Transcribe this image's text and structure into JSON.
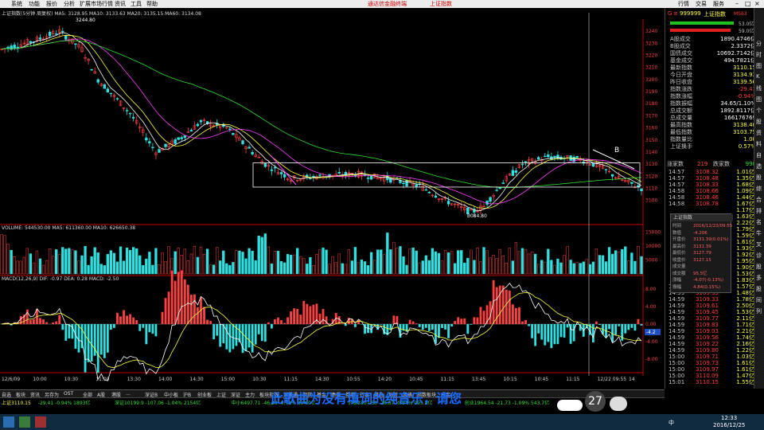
{
  "menu": {
    "items": [
      "系统",
      "功能",
      "报价",
      "分析",
      "扩展市场行情",
      "资讯",
      "工具",
      "帮助"
    ],
    "center_title": "通达信金融终端",
    "center_sub": "上证指数",
    "right_items": [
      "行情",
      "交易",
      "服务"
    ]
  },
  "main_chart": {
    "header": "上证指数(5分钟 周复权) MA5: 3128.95  MA10: 3133.63  MA20: 3135.15  MA60: 3134.08",
    "price_ticks": [
      "3240",
      "3230",
      "3220",
      "3210",
      "3200",
      "3190",
      "3180",
      "3170",
      "3160",
      "3150",
      "3140",
      "3130",
      "3120",
      "3110",
      "3100"
    ],
    "high_marker": "3244.80",
    "low_marker": "3084.80",
    "annotation_b": "B"
  },
  "volume_chart": {
    "header": "VOLUME: 544530.00  MA5: 611360.00  MA10: 626650.38",
    "ticks": [
      "15000",
      "10000",
      "5000",
      "X100"
    ]
  },
  "macd_chart": {
    "header": "MACD(12,26,9)  DIF: -0.97  DEA: 0.28  MACD: -2.50",
    "ticks": [
      "8.00",
      "4.00",
      "0.00",
      "-4.00",
      "-8.00"
    ],
    "marker": "-4.2"
  },
  "time_axis": [
    "12/6/09",
    "10:00",
    "10:30",
    "11:00",
    "13:30",
    "14:00",
    "14:30",
    "15:00",
    "10:30",
    "11:15",
    "14:30",
    "10:55",
    "14:20",
    "10:45",
    "11:15",
    "13:45",
    "10:15",
    "10:45",
    "11:15",
    "12/22 09:55",
    "14"
  ],
  "right_panel": {
    "code": "999999",
    "name": "上证指数",
    "tag": "MS63",
    "bar_a": "53.0亿",
    "bar_b": "59.0亿",
    "stats": [
      {
        "label": "A股成交",
        "value": "1890.4746亿"
      },
      {
        "label": "B股成交",
        "value": "2.3372亿"
      },
      {
        "label": "国债成交",
        "value": "10692.7142亿"
      },
      {
        "label": "基金成交",
        "value": "494.7821亿"
      },
      {
        "label": "最新指数",
        "value": "3110.15"
      },
      {
        "label": "今日开盘",
        "value": "3134.93"
      },
      {
        "label": "昨日收盘",
        "value": "3139.56"
      },
      {
        "label": "指数涨跌",
        "value": "-29.41"
      },
      {
        "label": "指数涨幅",
        "value": "-0.94%"
      },
      {
        "label": "指数振幅",
        "value": "34.65/1.10%"
      },
      {
        "label": "总成交额",
        "value": "1892.8117亿"
      },
      {
        "label": "总成交量",
        "value": "166176769"
      },
      {
        "label": "最高指数",
        "value": "3138.40"
      },
      {
        "label": "最低指数",
        "value": "3103.75"
      },
      {
        "label": "指数量比",
        "value": "1.00"
      },
      {
        "label": "上证换手",
        "value": "0.57%"
      }
    ],
    "updown": {
      "up_label": "涨家数",
      "up": "219",
      "down_label": "跌家数",
      "down": "998"
    },
    "trades": [
      {
        "t": "14:57",
        "p": "3108.32",
        "v": "1.01亿"
      },
      {
        "t": "14:57",
        "p": "3108.48",
        "v": "1.35亿"
      },
      {
        "t": "14:57",
        "p": "3108.33",
        "v": "1.68亿"
      },
      {
        "t": "14:58",
        "p": "3108.66",
        "v": "1.09亿"
      },
      {
        "t": "14:58",
        "p": "3108.46",
        "v": "1.44亿"
      },
      {
        "t": "14:58",
        "p": "3108.78",
        "v": "1.67亿"
      },
      {
        "t": "",
        "p": "",
        "v": "1.17亿"
      },
      {
        "t": "",
        "p": "",
        "v": "1.63亿"
      },
      {
        "t": "",
        "p": "",
        "v": "2.22亿"
      },
      {
        "t": "",
        "p": "",
        "v": "1.79亿"
      },
      {
        "t": "",
        "p": "",
        "v": "1.59亿"
      },
      {
        "t": "",
        "p": "",
        "v": "1.61亿"
      },
      {
        "t": "",
        "p": "",
        "v": "1.93亿"
      },
      {
        "t": "",
        "p": "",
        "v": "1.92亿"
      },
      {
        "t": "",
        "p": "",
        "v": "1.95亿"
      },
      {
        "t": "",
        "p": "",
        "v": "1.90亿"
      },
      {
        "t": "",
        "p": "",
        "v": "1.53亿"
      },
      {
        "t": "",
        "p": "",
        "v": "1.83亿"
      },
      {
        "t": "14:59",
        "p": "3109.47",
        "v": "1.57亿"
      },
      {
        "t": "14:59",
        "p": "3109.35",
        "v": "1.48亿"
      },
      {
        "t": "14:59",
        "p": "3109.33",
        "v": "1.78亿"
      },
      {
        "t": "14:59",
        "p": "3109.61",
        "v": "2.50亿"
      },
      {
        "t": "14:59",
        "p": "3109.45",
        "v": "1.53亿"
      },
      {
        "t": "14:59",
        "p": "3109.77",
        "v": "2.11亿"
      },
      {
        "t": "14:59",
        "p": "3109.83",
        "v": "1.71亿"
      },
      {
        "t": "14:59",
        "p": "3109.03",
        "v": "2.21亿"
      },
      {
        "t": "14:59",
        "p": "3109.56",
        "v": "1.74亿"
      },
      {
        "t": "14:59",
        "p": "3109.22",
        "v": "2.16亿"
      },
      {
        "t": "14:59",
        "p": "3109.80",
        "v": "1.22亿"
      },
      {
        "t": "15:00",
        "p": "3109.71",
        "v": "1.03亿"
      },
      {
        "t": "15:00",
        "p": "3109.73",
        "v": "1.61亿"
      },
      {
        "t": "15:00",
        "p": "3109.97",
        "v": "1.61亿"
      },
      {
        "t": "15:00",
        "p": "3110.09",
        "v": "1.47亿"
      },
      {
        "t": "15:01",
        "p": "3110.15",
        "v": "1.55亿"
      }
    ],
    "popup": {
      "title": "上证指数",
      "rows": [
        {
          "label": "时间",
          "value": "2016/12/23/09:55"
        },
        {
          "label": "数值",
          "value": "-4.206"
        },
        {
          "label": "开盘价",
          "value": "3131.39(0.01%)"
        },
        {
          "label": "最高价",
          "value": "3131.39"
        },
        {
          "label": "最低价",
          "value": "3127.79"
        },
        {
          "label": "收盘价",
          "value": "3127.15"
        },
        {
          "label": "成交量",
          "value": ""
        },
        {
          "label": "成交额",
          "value": "95.5亿"
        },
        {
          "label": "涨幅",
          "value": "-4.07(-0.13%)"
        },
        {
          "label": "振幅",
          "value": "4.84(0.15%)"
        }
      ]
    }
  },
  "tabbar": [
    "自选",
    "板块",
    "资讯",
    "另存为",
    "OST",
    "全部",
    "A股",
    "港股",
    "...",
    "深证B",
    "中小板",
    "沪B",
    "创业板",
    "上证",
    "深证",
    "主力",
    "板块指数",
    "港股通",
    "期货",
    "基金",
    "债券",
    "券商",
    "行业",
    "概念",
    "地区",
    "风格",
    "指数板块",
    "自定"
  ],
  "index_strip": [
    {
      "text": "上证3110.15",
      "cls": "yellow"
    },
    {
      "text": "-29.41  -0.94%  1893亿",
      "cls": "green"
    },
    {
      "text": "深证10199.9  -107.06  -1.04%  2154亿",
      "cls": "green"
    },
    {
      "text": "中小6497.71  -46.23  -0.71%  894.0亿",
      "cls": "green"
    },
    {
      "text": "沪深3307.50  -28.87  -0.84%  995.8亿",
      "cls": "green"
    },
    {
      "text": "创业1964.54  -21.73  -1.09%  543.7亿",
      "cls": "green"
    }
  ],
  "subtitle": "此歌曲为没有填词的纯音乐，请您",
  "bubble_value": "27",
  "sidebar_labels": [
    "分",
    "时",
    "图",
    "K",
    "线",
    "图",
    "个",
    "股",
    "资",
    "料",
    "自",
    "选",
    "股",
    "综",
    "合",
    "排",
    "名",
    "牛",
    "叉",
    "诊",
    "股",
    "多",
    "股",
    "同",
    "列"
  ],
  "taskbar": {
    "time": "12:33",
    "date": "2016/12/25",
    "lang": "中"
  },
  "colors": {
    "up": "#ff4040",
    "down": "#30e0e0",
    "ma5": "#ffffff",
    "ma10": "#ffff40",
    "ma20": "#ff40ff",
    "ma60": "#30e030"
  }
}
